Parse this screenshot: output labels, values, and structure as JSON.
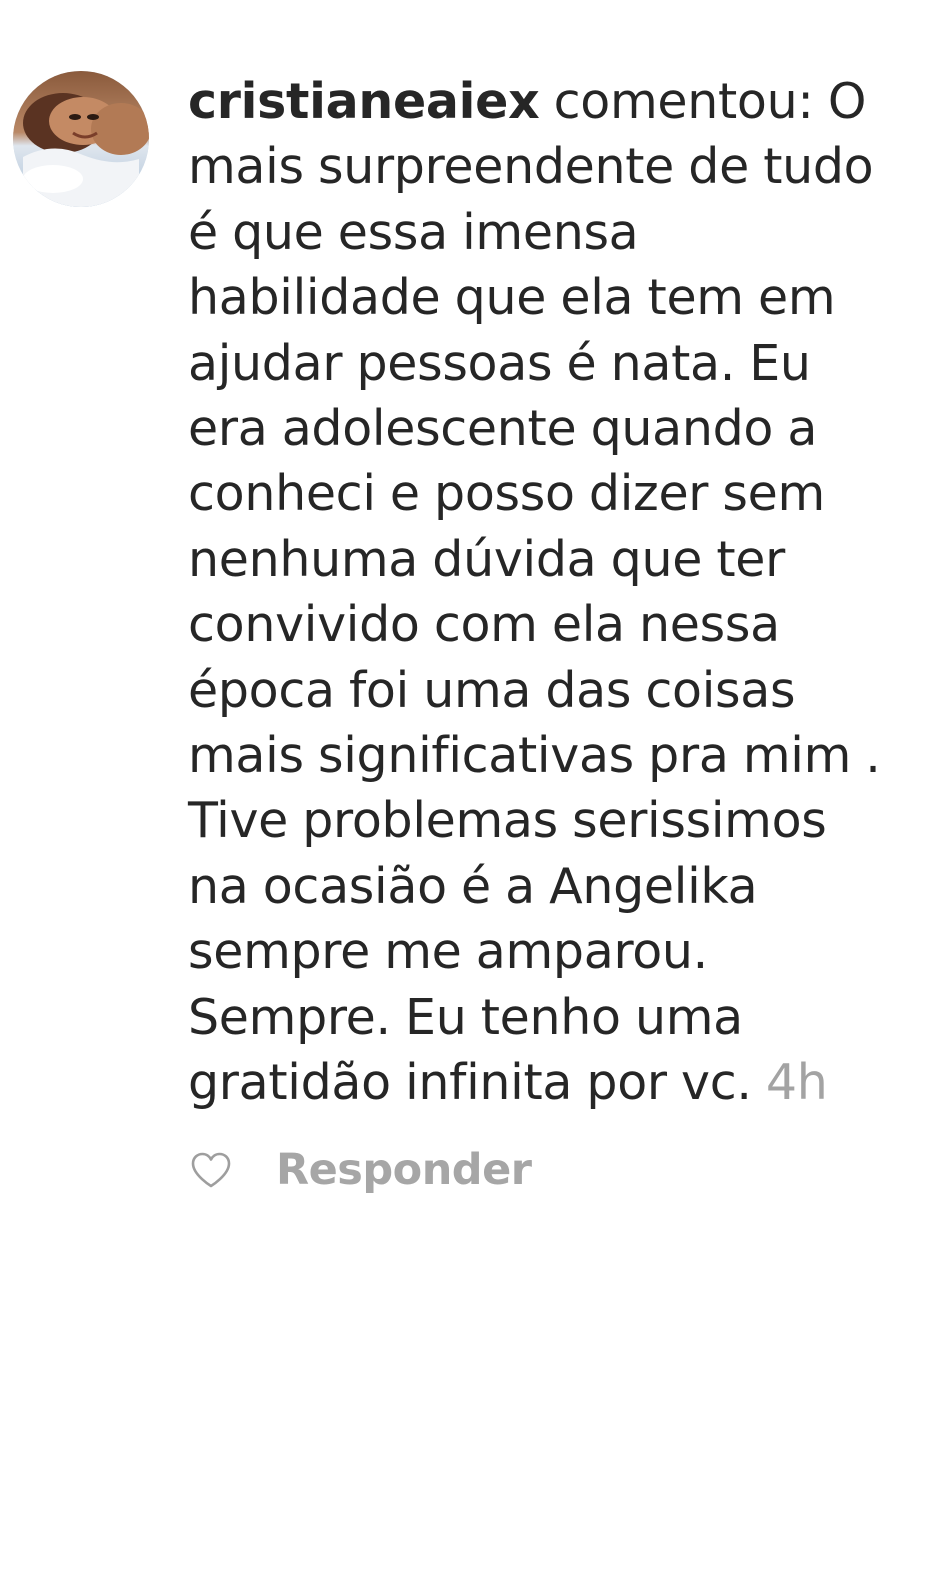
{
  "comment": {
    "username": "cristianeaiex",
    "verb": "comentou:",
    "lines": [
      "O",
      "mais surpreendente de tudo",
      "é que essa imensa",
      "habilidade que ela tem em",
      "ajudar pessoas é nata. Eu",
      "era adolescente quando a",
      "conheci e posso dizer sem",
      "nenhuma dúvida que ter",
      "convivido com ela nessa",
      "época foi uma das coisas",
      "mais significativas pra mim .",
      "Tive problemas serissimos",
      "na ocasião é a Angelika",
      "sempre me amparou.",
      "Sempre. Eu tenho uma",
      "gratidão infinita por vc."
    ],
    "timestamp": "4h"
  },
  "actions": {
    "like_icon": "heart-outline-icon",
    "reply_label": "Responder"
  },
  "colors": {
    "text": "#262626",
    "muted": "#a3a3a3",
    "background": "#ffffff"
  }
}
